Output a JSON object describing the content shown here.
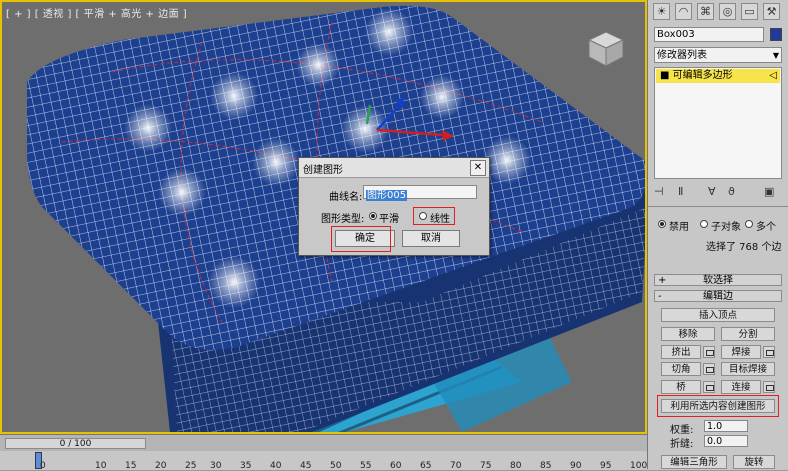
{
  "viewport": {
    "label": "[ + ] [ 透视 ] [ 平滑 + 高光 + 边面 ]"
  },
  "dialog": {
    "title": "创建图形",
    "close_glyph": "✕",
    "name_label": "曲线名:",
    "name_value": "图形005",
    "type_label": "图形类型:",
    "option_smooth": "平滑",
    "option_linear": "线性",
    "selected_option": "平滑",
    "ok_label": "确定",
    "cancel_label": "取消"
  },
  "panel": {
    "toolbar_icons": [
      "sun-icon",
      "curve-icon",
      "hierarchy-icon",
      "motion-icon",
      "display-icon",
      "utilities-icon"
    ],
    "object_name": "Box003",
    "object_color": "#1f3a9a",
    "modifier_list": "修改器列表",
    "stack_item": "可编辑多边形",
    "selection_options": {
      "disable": "禁用",
      "subobject": "子对象",
      "multiple": "多个"
    },
    "selection_status": "选择了 768 个边",
    "soft_selection": "软选择",
    "edit_edges": "编辑边",
    "insert_vertex": "插入顶点",
    "remove": "移除",
    "split": "分割",
    "extrude": "挤出",
    "weld": "焊接",
    "chamfer": "切角",
    "target_weld": "目标焊接",
    "bridge": "桥",
    "connect": "连接",
    "create_shape": "利用所选内容创建图形",
    "weight_label": "权重:",
    "weight_value": "1.0",
    "crease_label": "折缝:",
    "crease_value": "0.0",
    "edit_tri": "编辑三角形",
    "rotate": "旋转"
  },
  "timeline": {
    "slider_text": "0 / 100",
    "ticks": [
      "0",
      "10",
      "15",
      "20",
      "25",
      "30",
      "35",
      "40",
      "45",
      "50",
      "55",
      "60",
      "65",
      "70",
      "75",
      "80",
      "85",
      "90",
      "95",
      "100"
    ]
  },
  "colors": {
    "viewport_border": "#e8c200",
    "mesh_fill": "#1c3f8f",
    "mesh_wire": "#e8eef8",
    "highlight": "#e02020",
    "stack_highlight": "#f7e34a"
  }
}
